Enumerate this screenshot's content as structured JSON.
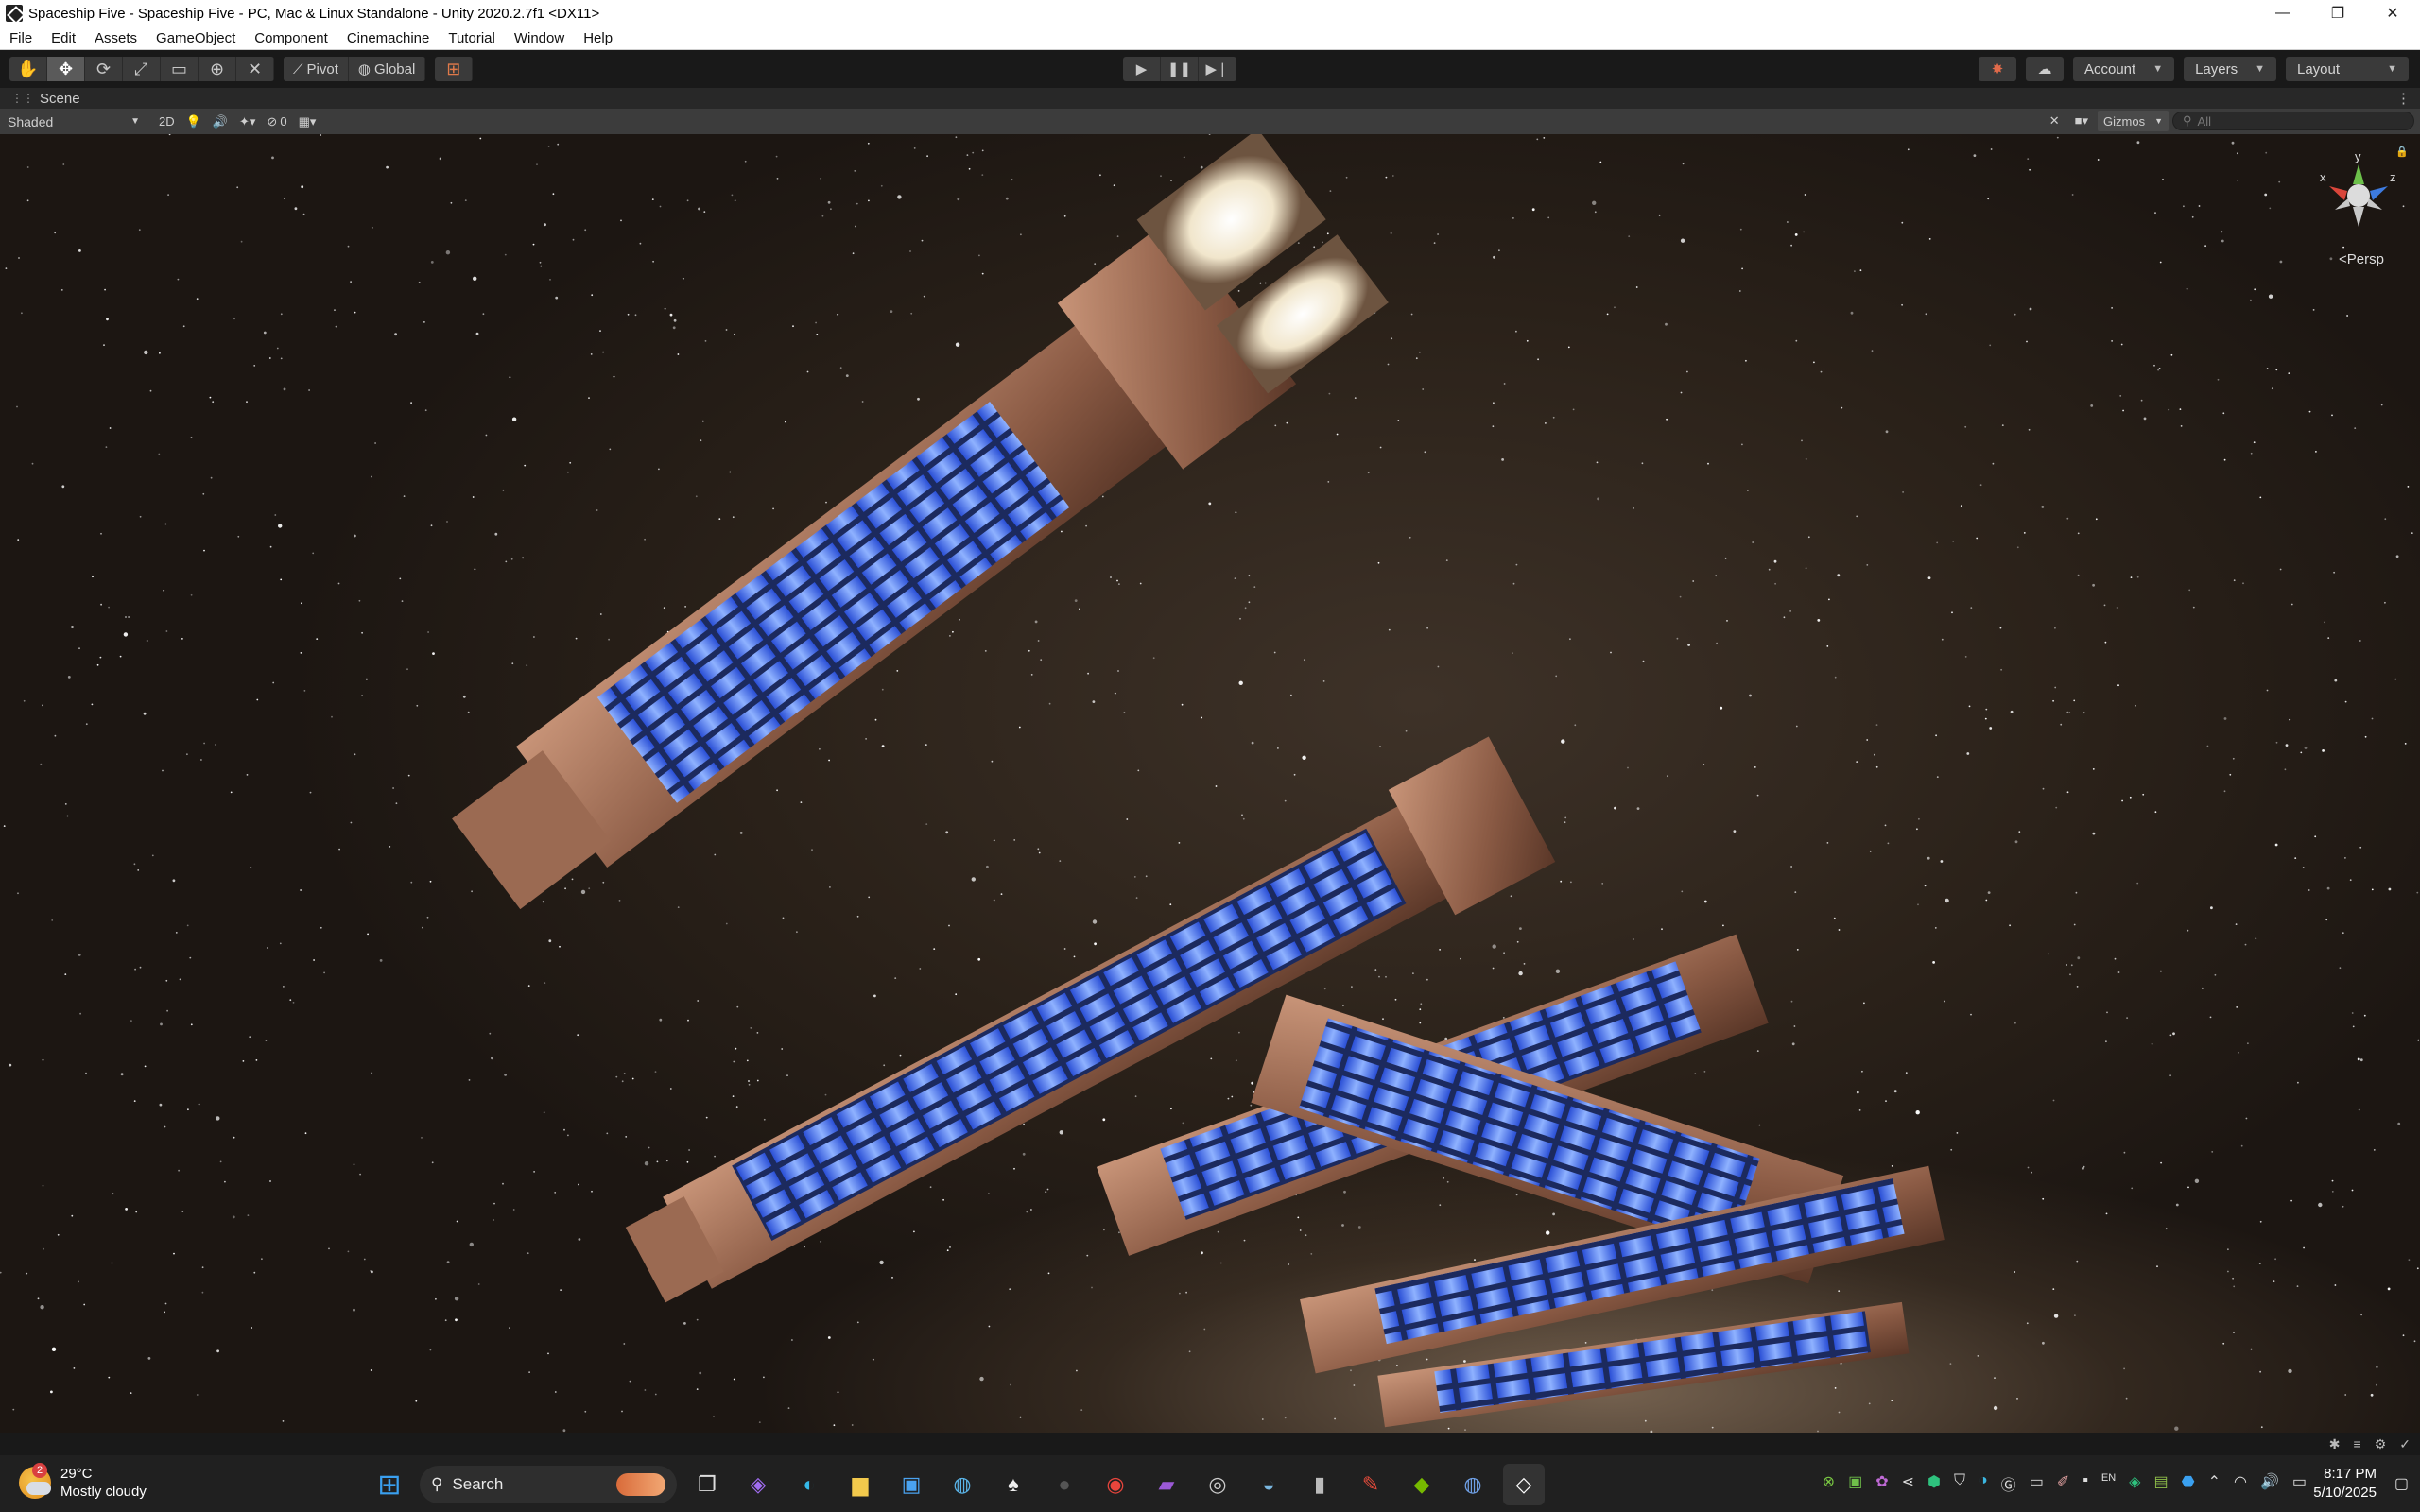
{
  "window": {
    "title": "Spaceship Five - Spaceship Five - PC, Mac & Linux Standalone - Unity 2020.2.7f1 <DX11>",
    "controls": [
      "—",
      "❐",
      "✕"
    ]
  },
  "menu": [
    "File",
    "Edit",
    "Assets",
    "GameObject",
    "Component",
    "Cinemachine",
    "Tutorial",
    "Window",
    "Help"
  ],
  "toolbar": {
    "pivot_label": "Pivot",
    "global_label": "Global",
    "account_label": "Account",
    "layers_label": "Layers",
    "layout_label": "Layout"
  },
  "scene": {
    "tab_label": "Scene",
    "shading_mode": "Shaded",
    "mode_2d": "2D",
    "hidden_count": "0",
    "gizmos_label": "Gizmos",
    "search_placeholder": "All",
    "projection_label": "Persp",
    "axis_x": "x",
    "axis_y": "y",
    "axis_z": "z"
  },
  "taskbar": {
    "temperature": "29°C",
    "weather": "Mostly cloudy",
    "weather_badge": "2",
    "search_label": "Search",
    "time": "8:17 PM",
    "date": "5/10/2025"
  },
  "colors": {
    "accent": "#3d7be0",
    "ship_glow": "#4f7dff",
    "hull": "#9b6a52"
  }
}
